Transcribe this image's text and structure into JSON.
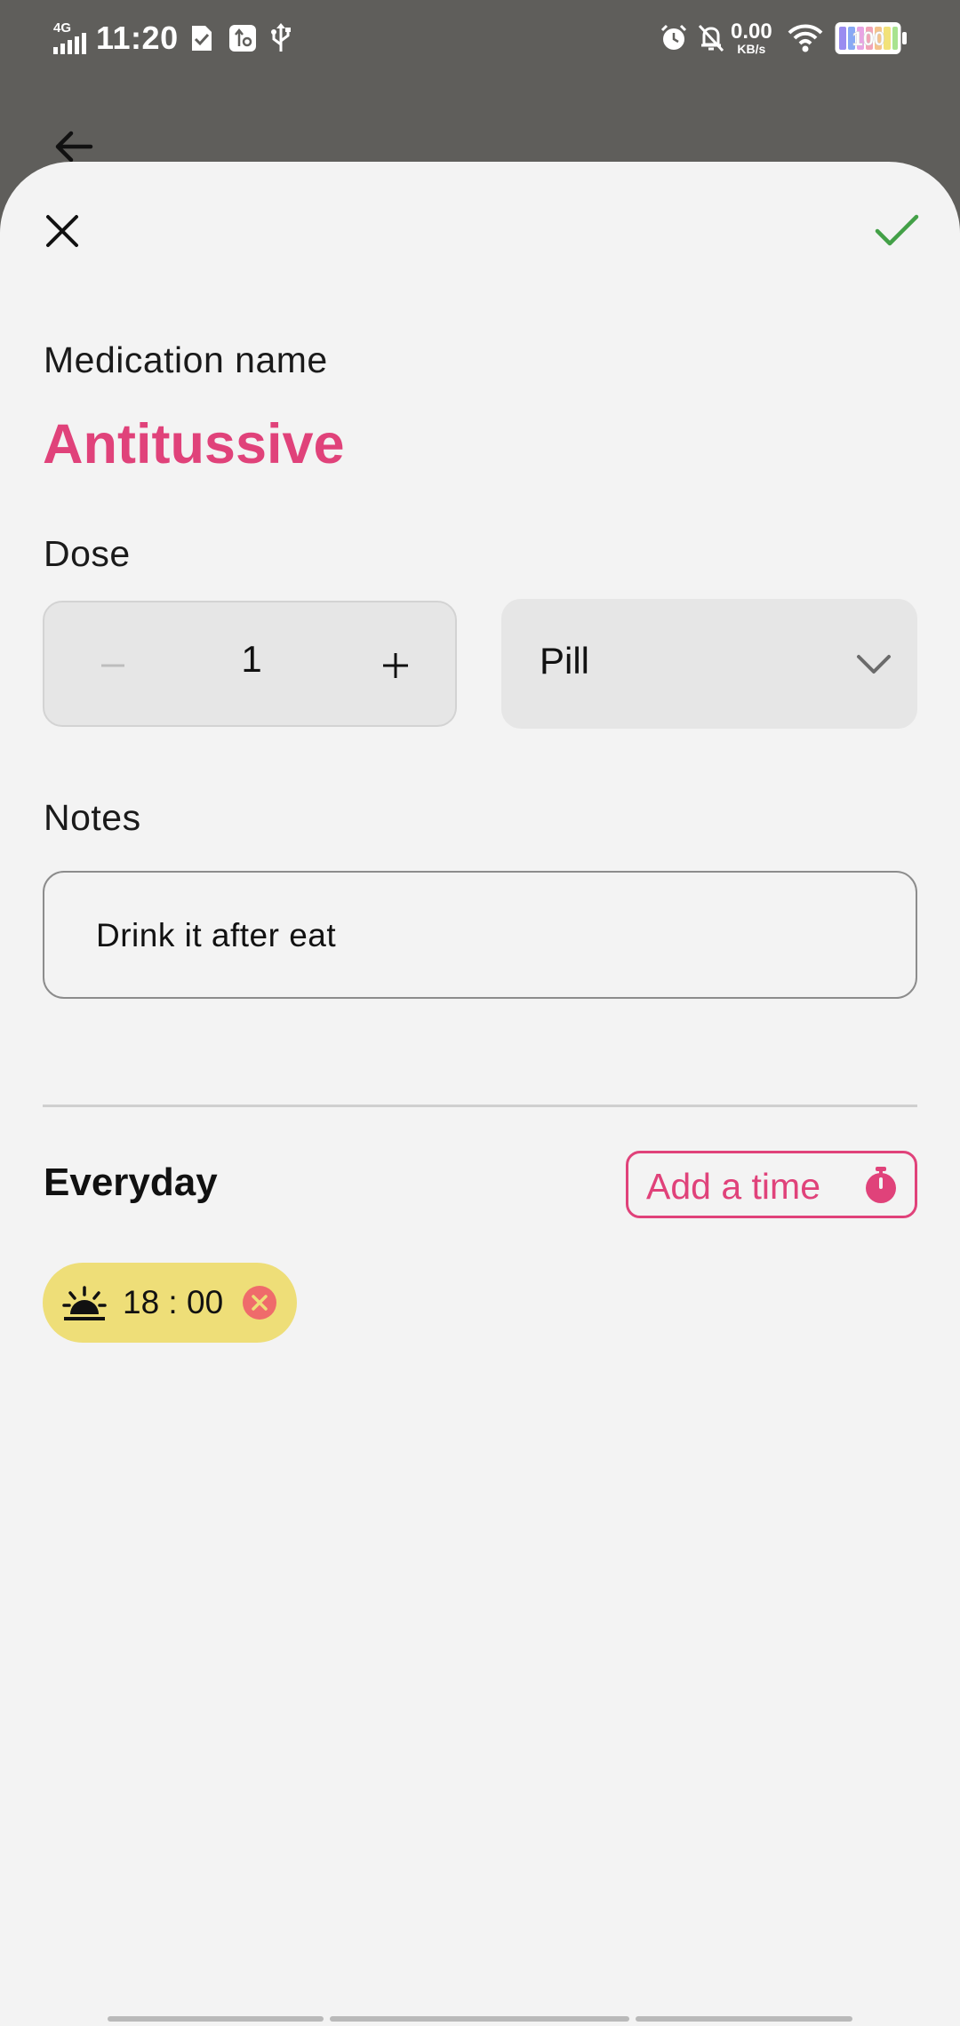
{
  "status_bar": {
    "network_type": "4G",
    "time": "11:20",
    "speed_value": "0.00",
    "speed_unit": "KB/s",
    "battery_level": "100",
    "icons": [
      "signal-icon",
      "sim-check-icon",
      "usb-settings-icon",
      "usb-icon",
      "alarm-icon",
      "bell-off-icon",
      "wifi-icon",
      "battery-icon"
    ]
  },
  "header": {
    "back_icon": "arrow-left-icon"
  },
  "sheet": {
    "close_icon": "close-icon",
    "confirm_icon": "check-icon",
    "confirm_color": "#43a047",
    "medication_label": "Medication name",
    "medication_name": "Antitussive",
    "accent_color": "#e0427a",
    "dose_label": "Dose",
    "dose": {
      "value": "1",
      "decrement_symbol": "−",
      "increment_symbol": "+"
    },
    "unit": {
      "selected": "Pill"
    },
    "notes_label": "Notes",
    "notes_value": "Drink it after eat",
    "frequency_label": "Everyday",
    "add_time_label": "Add a time",
    "times": [
      {
        "hour": "18",
        "minute": "00",
        "display": "18 : 00",
        "icon": "sunset-icon",
        "chip_color": "#eede78",
        "remove_color": "#ef6b6b"
      }
    ]
  }
}
